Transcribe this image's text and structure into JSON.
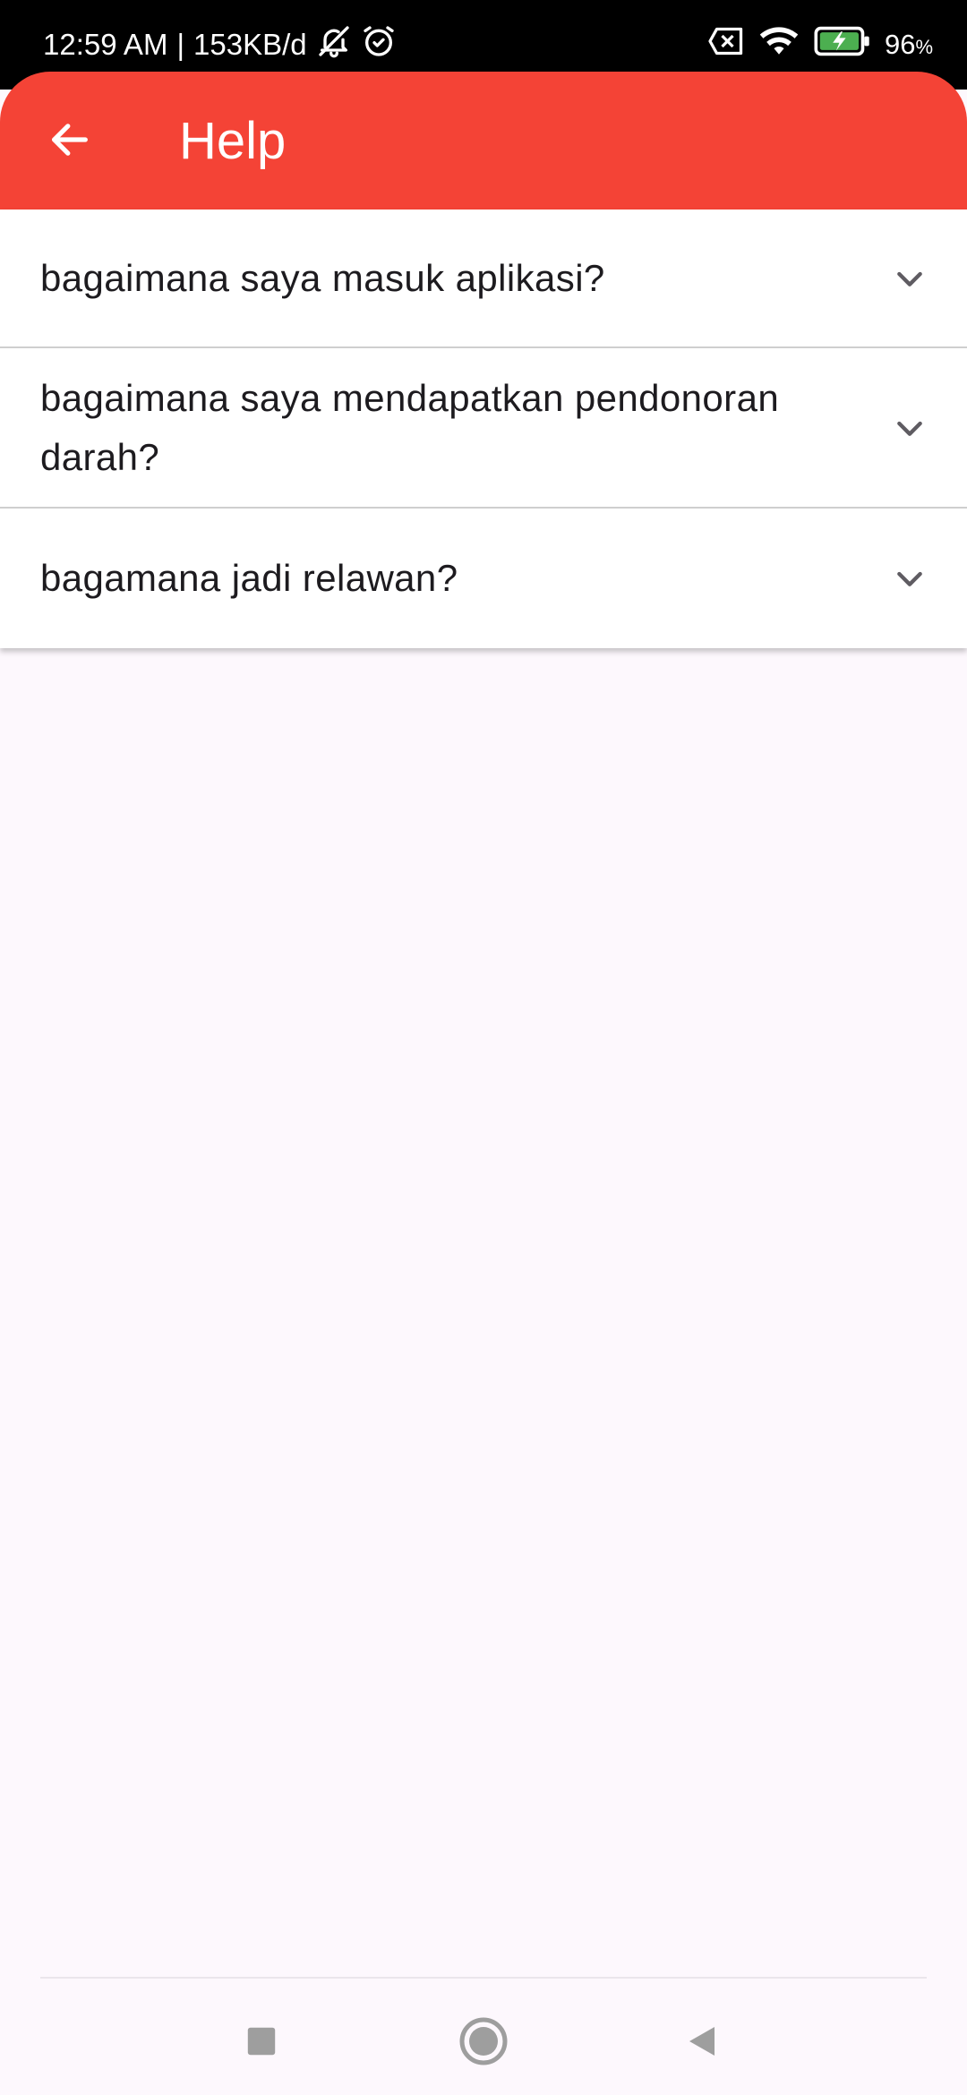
{
  "status_bar": {
    "time": "12:59 AM",
    "separator": "|",
    "network_speed": "153KB/d",
    "battery_percent": "96",
    "battery_unit": "%",
    "icons": [
      "mute-bell-icon",
      "alarm-icon",
      "sim-off-icon",
      "wifi-icon",
      "battery-charging-icon"
    ]
  },
  "app_bar": {
    "title": "Help",
    "back_icon": "arrow-back-icon",
    "color": "#f44336"
  },
  "faq": {
    "items": [
      {
        "question": "bagaimana saya masuk aplikasi?",
        "icon": "chevron-down-icon"
      },
      {
        "question": "bagaimana saya mendapatkan pendonoran darah?",
        "icon": "chevron-down-icon"
      },
      {
        "question": "bagamana jadi relawan?",
        "icon": "chevron-down-icon"
      }
    ]
  },
  "nav_bar": {
    "buttons": [
      "recent-apps-icon",
      "home-icon",
      "back-icon"
    ]
  }
}
